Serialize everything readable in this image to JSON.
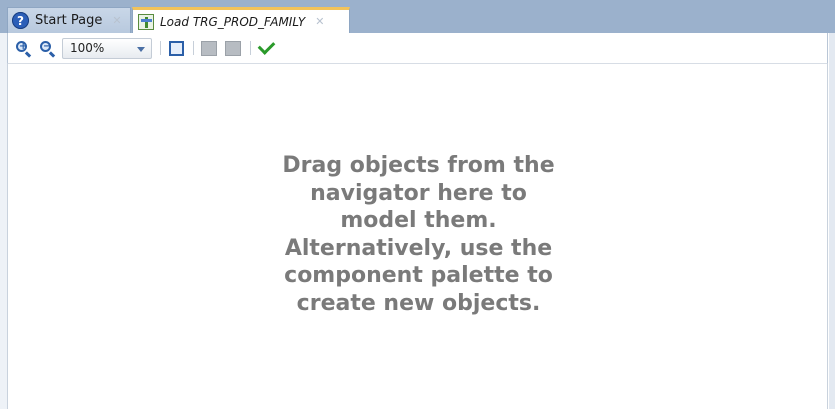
{
  "tabs": [
    {
      "label": "Start Page",
      "icon": "help-icon",
      "active": false
    },
    {
      "label": "Load TRG_PROD_FAMILY",
      "icon": "mapping-icon",
      "active": true
    }
  ],
  "toolbar": {
    "zoom_in_icon": "zoom-in-icon",
    "zoom_out_icon": "zoom-out-icon",
    "zoom_value": "100%",
    "fit_icon": "fit-to-window-icon",
    "validate_icon": "checkmark-icon"
  },
  "canvas": {
    "hint_lines": [
      "Drag objects from the",
      "navigator here to",
      "model them.",
      "Alternatively, use the",
      "component palette to",
      "create new objects."
    ]
  },
  "colors": {
    "tabbar": "#9bb1cc",
    "active_tab_accent": "#f2c35a",
    "hint_text": "#7a7a7a"
  }
}
